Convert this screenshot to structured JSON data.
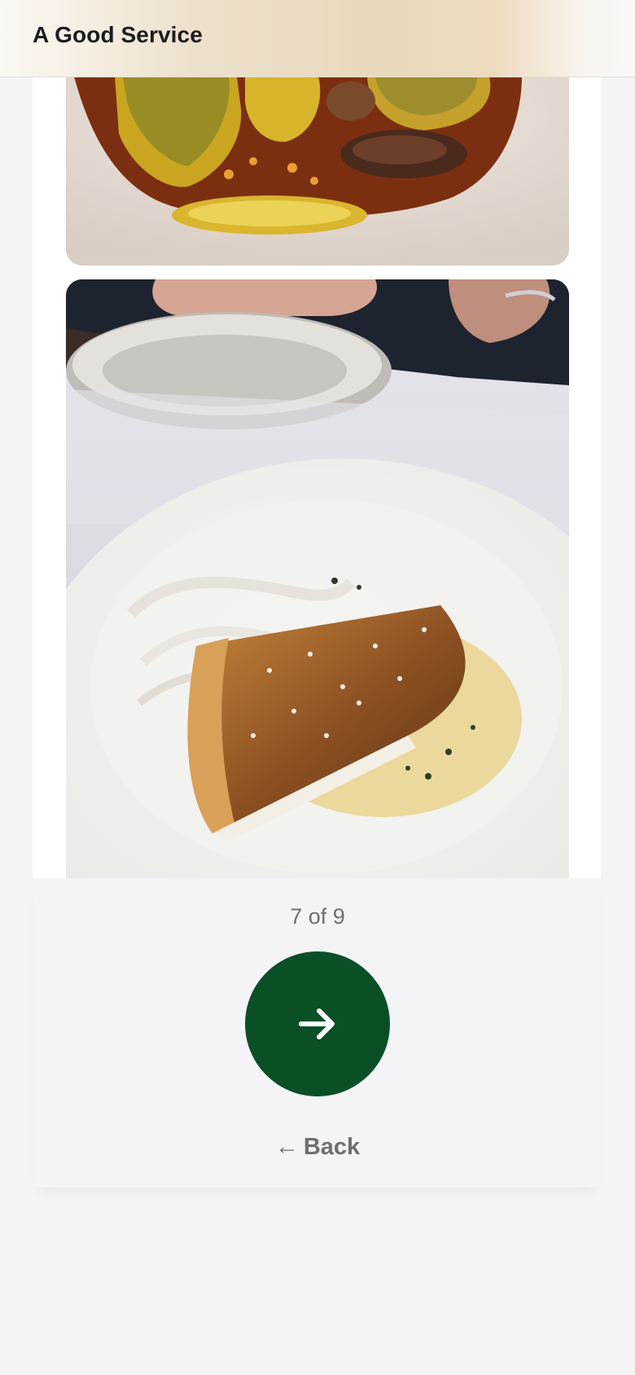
{
  "header": {
    "title": "A Good Service"
  },
  "gallery": {
    "images": [
      {
        "subject": "ravioli-dish-photo"
      },
      {
        "subject": "seared-fish-dish-photo"
      }
    ],
    "counter": "7 of 9"
  },
  "navigation": {
    "next_icon": "arrow-right-icon",
    "back_arrow": "←",
    "back_label": "Back"
  },
  "colors": {
    "accent": "#0b4f27",
    "background": "#f4f4f6",
    "muted_text": "#6e6e73"
  }
}
